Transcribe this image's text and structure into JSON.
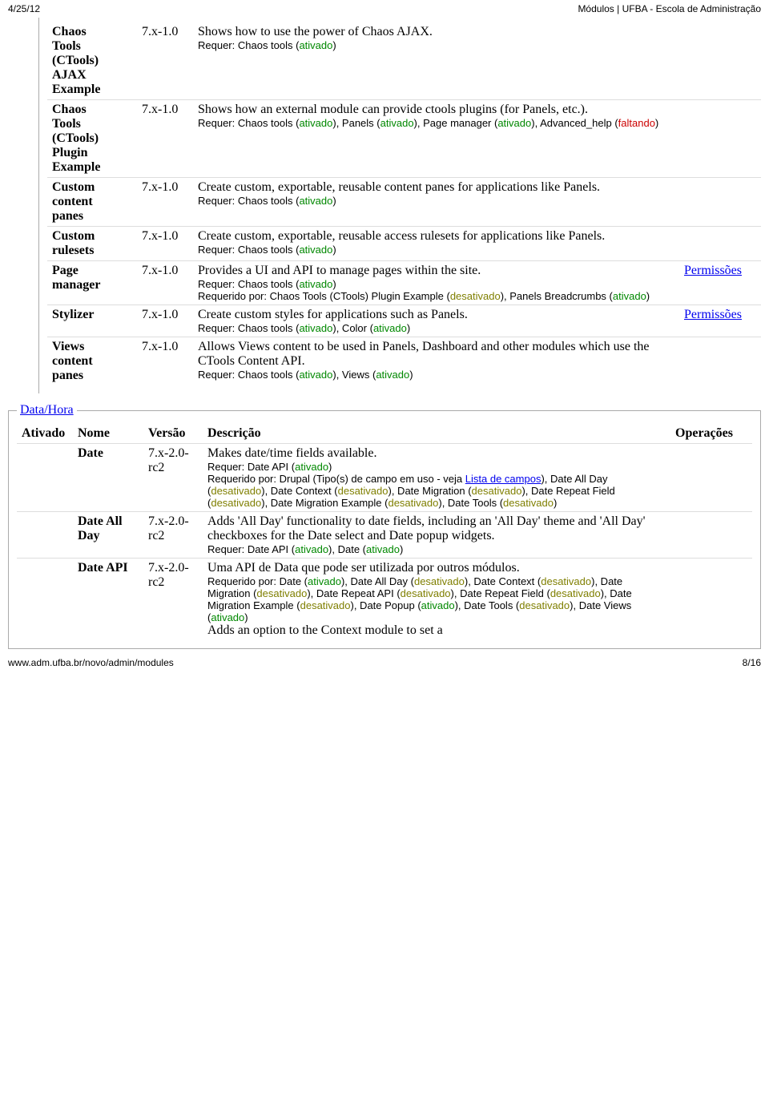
{
  "header": {
    "date": "4/25/12",
    "title": "Módulos | UFBA - Escola de Administração"
  },
  "footer": {
    "url": "www.adm.ufba.br/novo/admin/modules",
    "pages": "8/16"
  },
  "status": {
    "ativado": "ativado",
    "desativado": "desativado",
    "faltando": "faltando"
  },
  "labels": {
    "permissoes": "Permissões",
    "requer": "Requer: ",
    "requerido": "Requerido por: "
  },
  "ctools": {
    "rows": [
      {
        "name_html": "Chaos<br>Tools<br>(CTools)<br>AJAX<br>Example",
        "version": "7.x-1.0",
        "desc_main": "Shows how to use the power of Chaos AJAX.",
        "req_text": "Chaos tools (",
        "ops": ""
      },
      {
        "name_html": "Chaos<br>Tools<br>(CTools)<br>Plugin<br>Example",
        "version": "7.x-1.0",
        "desc_main": "Shows how an external module can provide ctools plugins (for Panels, etc.).",
        "req_plugin": true,
        "ops": ""
      },
      {
        "name_html": "Custom<br>content<br>panes",
        "version": "7.x-1.0",
        "desc_main": "Create custom, exportable, reusable content panes for applications like Panels.",
        "req_simple": true,
        "ops": ""
      },
      {
        "name_html": "Custom<br>rulesets",
        "version": "7.x-1.0",
        "desc_main": "Create custom, exportable, reusable access rulesets for applications like Panels.",
        "req_simple": true,
        "ops": ""
      },
      {
        "name_html": "Page<br>manager",
        "version": "7.x-1.0",
        "desc_main": "Provides a UI and API to manage pages within the site.",
        "req_page": true,
        "ops": "perm"
      },
      {
        "name_html": "Stylizer",
        "version": "7.x-1.0",
        "desc_main": "Create custom styles for applications such as Panels.",
        "req_stylizer": true,
        "ops": "perm"
      },
      {
        "name_html": "Views<br>content<br>panes",
        "version": "7.x-1.0",
        "desc_main": "Allows Views content to be used in Panels, Dashboard and other modules which use the CTools Content API.",
        "req_views": true,
        "ops": ""
      }
    ]
  },
  "datahora": {
    "legend": "Data/Hora",
    "head": {
      "c1": "Ativado",
      "c2": "Nome",
      "c3": "Versão",
      "c4": "Descrição",
      "c5": "Operações"
    },
    "rows": [
      {
        "name": "Date",
        "version": "7.x-2.0-rc2",
        "desc_main": "Makes date/time fields available.",
        "date1": true
      },
      {
        "name": "Date All Day",
        "version": "7.x-2.0-rc2",
        "desc_main": "Adds 'All Day' functionality to date fields, including an 'All Day' theme and 'All Day' checkboxes for the Date select and Date popup widgets.",
        "date2": true
      },
      {
        "name": "Date API",
        "version": "7.x-2.0-rc2",
        "desc_main": "Uma API de Data que pode ser utilizada por outros módulos.",
        "trail": "Adds an option to the Context module to set a",
        "date3": true
      }
    ],
    "lista_campos": "Lista de campos"
  }
}
